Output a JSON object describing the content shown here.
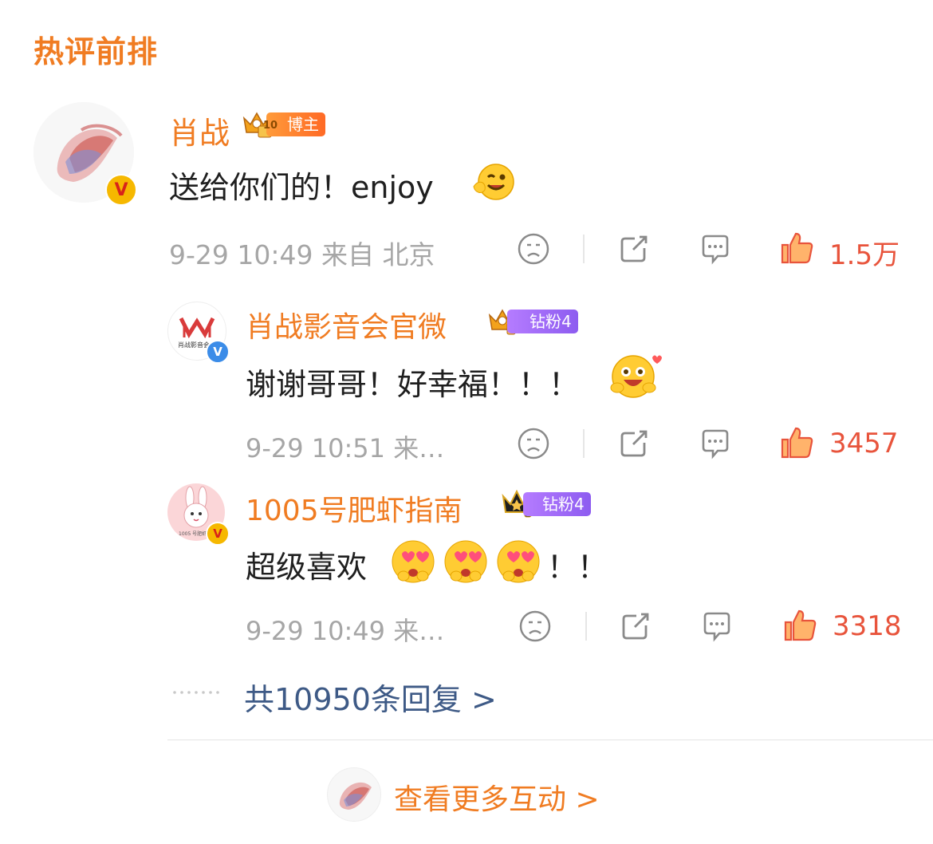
{
  "section": {
    "title": "热评前排"
  },
  "main_comment": {
    "author": "肖战",
    "badge": "博主",
    "crown_level": "10",
    "text": "送给你们的！enjoy",
    "emoji": "wink-emoji",
    "meta": "9-29 10:49 来自 北京",
    "likes": "1.5万"
  },
  "replies": [
    {
      "author": "肖战影音会官微",
      "badge": "钻粉4",
      "avatar_text": "肖战影音会",
      "text": "谢谢哥哥！好幸福！！！",
      "emoji": "happy-hug-emoji",
      "meta": "9-29 10:51 来…",
      "likes": "3457"
    },
    {
      "author": "1005号肥虾指南",
      "badge": "钻粉4",
      "avatar_text": "1005 号肥虾指南",
      "text": "超级喜欢",
      "emoji": "heart-eyes-emoji",
      "text_suffix": "！！",
      "meta": "9-29 10:49 来…",
      "likes": "3318"
    }
  ],
  "reply_link": "共10950条回复 >",
  "more_link": "查看更多互动 >",
  "colors": {
    "accent": "#f07c22",
    "like": "#e8543c",
    "link": "#3e5a86",
    "meta": "#a6a6a6"
  }
}
